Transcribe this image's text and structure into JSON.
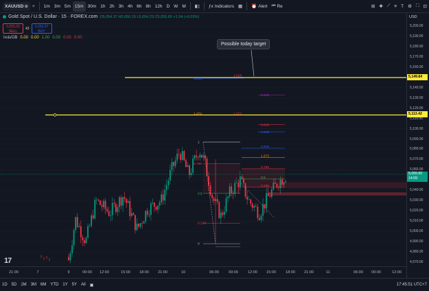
{
  "symbol": "XAUUSD",
  "title": "Gold Spot / U.S. Dollar · 15 · FOREX.com",
  "ohlc": "O5,054.37 H5,056.15 L5,054.23 C5,055.60 +1.34 (+0.03%)",
  "sell": {
    "price": "5,055.33",
    "label": "SELL"
  },
  "spread": "43",
  "buy": {
    "price": "5,056.07",
    "label": "BUY"
  },
  "timeframes": [
    "1m",
    "3m",
    "5m",
    "15m",
    "30m",
    "1h",
    "2h",
    "3h",
    "4h",
    "6h",
    "8h",
    "12h",
    "D",
    "W",
    "M"
  ],
  "active_timeframe": "15m",
  "toolbar": {
    "indicators": "Indicators",
    "alert": "Alert",
    "replay": "Re",
    "currency": "USD"
  },
  "indicator_row": {
    "name": "Imb/OB",
    "values": [
      "0.00",
      "0.00",
      "1.00",
      "0.00",
      "0.00",
      "0.00"
    ],
    "value_colors": [
      "#ffeb3b",
      "#ffeb3b",
      "#4caf50",
      "#4caf50",
      "#f23645",
      "#f23645"
    ]
  },
  "annotation": "Possible today target",
  "price_axis": [
    "5,200.00",
    "5,190.00",
    "5,180.00",
    "5,170.00",
    "5,160.00",
    "5,150.00",
    "5,140.00",
    "5,130.00",
    "5,120.00",
    "5,110.00",
    "5,100.00",
    "5,090.00",
    "5,080.00",
    "5,070.00",
    "5,060.00",
    "5,050.00",
    "5,040.00",
    "5,030.00",
    "5,020.00",
    "5,010.00",
    "5,000.00",
    "4,990.00",
    "4,980.00",
    "4,970.00"
  ],
  "price_tags": {
    "line1": "5,149.84",
    "line2": "5,113.42",
    "current": "5,055.60",
    "countdown": "14:09"
  },
  "fib_labels": {
    "ext1": [
      "1.618",
      "1.618"
    ],
    "ext2": [
      "1.272",
      "1.272"
    ],
    "fib_a": [
      "1",
      "0.786",
      "0.5",
      "0.236",
      "0"
    ],
    "fib_b": [
      "1.618",
      "1.272",
      "0.786",
      "0.5",
      "0.236"
    ],
    "fib_b_ext": [
      "1.618",
      "2.618",
      "2.618"
    ]
  },
  "time_axis": [
    "21:00",
    "7",
    "9",
    "09:00",
    "12:00",
    "15:00",
    "18:00",
    "21:00",
    "10",
    "06:00",
    "09:00",
    "12:00",
    "15:00",
    "18:00",
    "21:00",
    "11",
    "06:00",
    "09:00",
    "12:00"
  ],
  "bottom_ranges": [
    "1D",
    "5D",
    "1M",
    "3M",
    "6M",
    "YTD",
    "1Y",
    "5Y",
    "All"
  ],
  "clock": "17:45:51 UTC+7",
  "colors": {
    "bg": "#131722",
    "up": "#089981",
    "down": "#f23645",
    "yellow": "#ffeb3b",
    "fib_blue": "#2962ff",
    "fib_red": "#f23645",
    "fib_orange": "#ff9800",
    "fib_purple": "#9c27b0"
  }
}
